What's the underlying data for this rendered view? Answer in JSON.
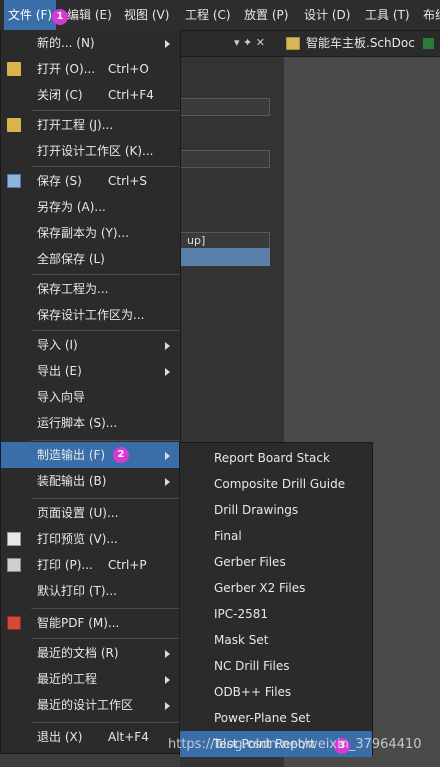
{
  "menubar": {
    "items": [
      "文件 (F)",
      "编辑 (E)",
      "视图 (V)",
      "工程 (C)",
      "放置 (P)",
      "设计 (D)",
      "工具 (T)",
      "布线"
    ],
    "active_index": 0,
    "step_badge": "1"
  },
  "panel": {
    "pin_controls": "▾ ✦ ✕",
    "row_text": "up]"
  },
  "document_tab": {
    "label": "智能车主板.SchDoc"
  },
  "file_menu": {
    "items": [
      {
        "label": "新的... (N)",
        "shortcut": "",
        "submenu": true,
        "icon": ""
      },
      {
        "label": "打开 (O)...",
        "shortcut": "Ctrl+O",
        "submenu": false,
        "icon": "folder-open-icon"
      },
      {
        "label": "关闭 (C)",
        "shortcut": "Ctrl+F4",
        "submenu": false,
        "icon": ""
      },
      {
        "label": "打开工程 (J)...",
        "shortcut": "",
        "submenu": false,
        "icon": "open-project-icon"
      },
      {
        "label": "打开设计工作区 (K)...",
        "shortcut": "",
        "submenu": false,
        "icon": ""
      },
      {
        "label": "保存 (S)",
        "shortcut": "Ctrl+S",
        "submenu": false,
        "icon": "save-icon"
      },
      {
        "label": "另存为 (A)...",
        "shortcut": "",
        "submenu": false,
        "icon": ""
      },
      {
        "label": "保存副本为 (Y)...",
        "shortcut": "",
        "submenu": false,
        "icon": ""
      },
      {
        "label": "全部保存 (L)",
        "shortcut": "",
        "submenu": false,
        "icon": ""
      },
      {
        "label": "保存工程为...",
        "shortcut": "",
        "submenu": false,
        "icon": ""
      },
      {
        "label": "保存设计工作区为...",
        "shortcut": "",
        "submenu": false,
        "icon": ""
      },
      {
        "label": "导入 (I)",
        "shortcut": "",
        "submenu": true,
        "icon": ""
      },
      {
        "label": "导出 (E)",
        "shortcut": "",
        "submenu": true,
        "icon": ""
      },
      {
        "label": "导入向导",
        "shortcut": "",
        "submenu": false,
        "icon": ""
      },
      {
        "label": "运行脚本 (S)...",
        "shortcut": "",
        "submenu": false,
        "icon": ""
      },
      {
        "label": "制造输出 (F)",
        "shortcut": "",
        "submenu": true,
        "icon": ""
      },
      {
        "label": "装配输出 (B)",
        "shortcut": "",
        "submenu": true,
        "icon": ""
      },
      {
        "label": "页面设置 (U)...",
        "shortcut": "",
        "submenu": false,
        "icon": ""
      },
      {
        "label": "打印预览 (V)...",
        "shortcut": "",
        "submenu": false,
        "icon": "print-preview-icon"
      },
      {
        "label": "打印 (P)...",
        "shortcut": "Ctrl+P",
        "submenu": false,
        "icon": "printer-icon"
      },
      {
        "label": "默认打印 (T)...",
        "shortcut": "",
        "submenu": false,
        "icon": ""
      },
      {
        "label": "智能PDF (M)...",
        "shortcut": "",
        "submenu": false,
        "icon": "smart-pdf-icon"
      },
      {
        "label": "最近的文档 (R)",
        "shortcut": "",
        "submenu": true,
        "icon": ""
      },
      {
        "label": "最近的工程",
        "shortcut": "",
        "submenu": true,
        "icon": ""
      },
      {
        "label": "最近的设计工作区",
        "shortcut": "",
        "submenu": true,
        "icon": ""
      },
      {
        "label": "退出 (X)",
        "shortcut": "Alt+F4",
        "submenu": false,
        "icon": ""
      }
    ],
    "highlighted_index": 15,
    "step_badge": "2"
  },
  "fabrication_submenu": {
    "items": [
      "Report Board Stack",
      "Composite Drill Guide",
      "Drill Drawings",
      "Final",
      "Gerber Files",
      "Gerber X2 Files",
      "IPC-2581",
      "Mask Set",
      "NC Drill Files",
      "ODB++ Files",
      "Power-Plane Set",
      "Test Point Report"
    ],
    "highlighted_index": 11,
    "step_badge": "3"
  },
  "watermark": "https://blog.csdn.net/weixin_37964410"
}
